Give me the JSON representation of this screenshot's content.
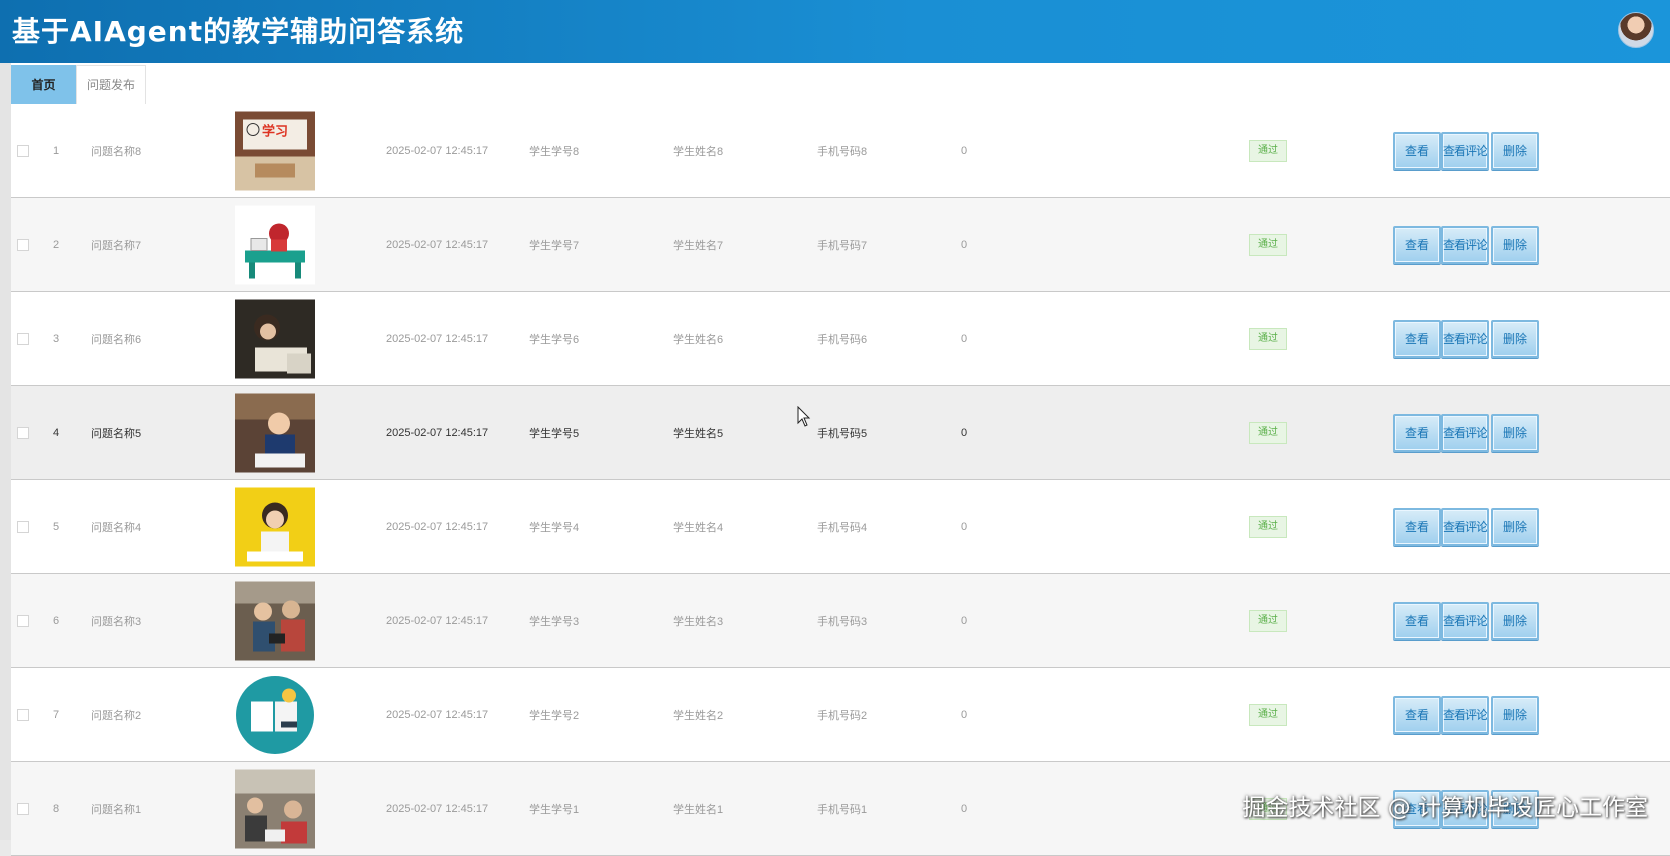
{
  "app": {
    "title": "基于AIAgent的教学辅助问答系统"
  },
  "tabs": [
    {
      "label": "首页",
      "active": true
    },
    {
      "label": "问题发布",
      "active": false
    }
  ],
  "rows": [
    {
      "index": "1",
      "name": "问题名称8",
      "time": "2025-02-07 12:45:17",
      "student_id": "学生学号8",
      "student_name": "学生姓名8",
      "phone": "手机号码8",
      "count": "0",
      "status": "通过",
      "image": "study-sign-image"
    },
    {
      "index": "2",
      "name": "问题名称7",
      "time": "2025-02-07 12:45:17",
      "student_id": "学生学号7",
      "student_name": "学生姓名7",
      "phone": "手机号码7",
      "count": "0",
      "status": "通过",
      "image": "student-desk-illustration"
    },
    {
      "index": "3",
      "name": "问题名称6",
      "time": "2025-02-07 12:45:17",
      "student_id": "学生学号6",
      "student_name": "学生姓名6",
      "phone": "手机号码6",
      "count": "0",
      "status": "通过",
      "image": "girl-reading-photo"
    },
    {
      "index": "4",
      "name": "问题名称5",
      "time": "2025-02-07 12:45:17",
      "student_id": "学生学号5",
      "student_name": "学生姓名5",
      "phone": "手机号码5",
      "count": "0",
      "status": "通过",
      "image": "boy-studying-photo"
    },
    {
      "index": "5",
      "name": "问题名称4",
      "time": "2025-02-07 12:45:17",
      "student_id": "学生学号4",
      "student_name": "学生姓名4",
      "phone": "手机号码4",
      "count": "0",
      "status": "通过",
      "image": "girl-yellow-background-photo"
    },
    {
      "index": "6",
      "name": "问题名称3",
      "time": "2025-02-07 12:45:17",
      "student_id": "学生学号3",
      "student_name": "学生姓名3",
      "phone": "手机号码3",
      "count": "0",
      "status": "通过",
      "image": "students-tablet-photo"
    },
    {
      "index": "7",
      "name": "问题名称2",
      "time": "2025-02-07 12:45:17",
      "student_id": "学生学号2",
      "student_name": "学生姓名2",
      "phone": "手机号码2",
      "count": "0",
      "status": "通过",
      "image": "book-lightbulb-icon"
    },
    {
      "index": "8",
      "name": "问题名称1",
      "time": "2025-02-07 12:45:17",
      "student_id": "学生学号1",
      "student_name": "学生姓名1",
      "phone": "手机号码1",
      "count": "0",
      "status": "通过",
      "image": "classroom-photo"
    }
  ],
  "actions": {
    "view": "查看",
    "comments": "查看评论",
    "delete": "删除"
  },
  "watermark": "掘金技术社区 @ 计算机毕设匠心工作室",
  "colors": {
    "header": "#1a8fd4",
    "tab_active": "#7fc2ea",
    "status_badge": "#5bb04a",
    "button_text": "#1a76b6"
  }
}
